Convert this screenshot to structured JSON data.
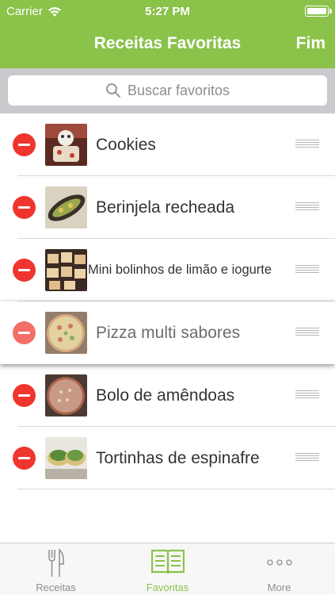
{
  "status_bar": {
    "carrier": "Carrier",
    "time": "5:27 PM"
  },
  "nav": {
    "title": "Receitas Favoritas",
    "done_label": "Fim"
  },
  "search": {
    "placeholder": "Buscar favoritos"
  },
  "favorites": [
    {
      "name": "Cookies",
      "thumb": "cookies"
    },
    {
      "name": "Berinjela recheada",
      "thumb": "eggplant"
    },
    {
      "name": "Mini bolinhos de limão e iogurte",
      "thumb": "muffins"
    },
    {
      "name": "Pizza multi sabores",
      "thumb": "pizza",
      "dragging": true
    },
    {
      "name": "Bolo de amêndoas",
      "thumb": "cake"
    },
    {
      "name": "Tortinhas de espinafre",
      "thumb": "tarts"
    }
  ],
  "tabbar": {
    "tabs": [
      {
        "label": "Receitas",
        "icon": "fork-knife-icon"
      },
      {
        "label": "Favoritas",
        "icon": "open-book-icon",
        "active": true
      },
      {
        "label": "More",
        "icon": "more-dots-icon"
      }
    ]
  },
  "colors": {
    "accent": "#8ac24a",
    "delete": "#f0352e"
  }
}
